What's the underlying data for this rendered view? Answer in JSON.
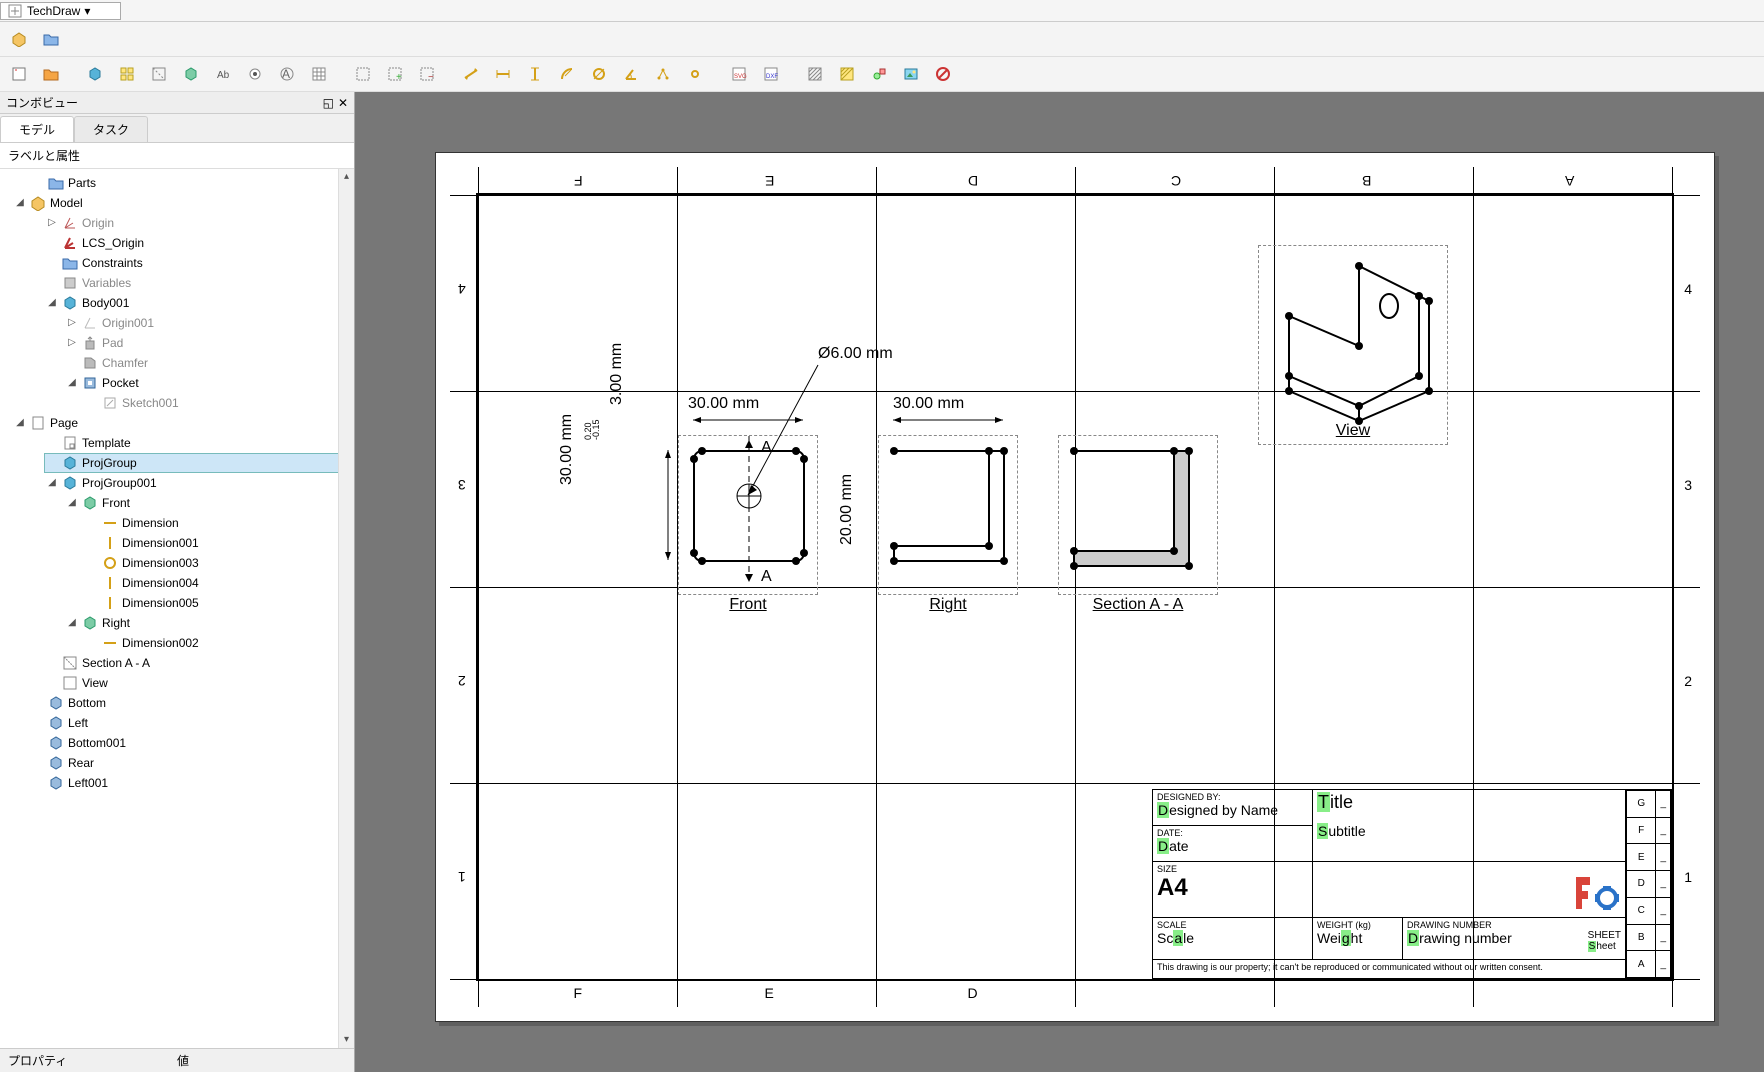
{
  "app": {
    "workbench": "TechDraw"
  },
  "left_panel": {
    "title": "コンボビュー",
    "tabs": {
      "model": "モデル",
      "task": "タスク"
    },
    "labels_header": "ラベルと属性",
    "prop_header": {
      "property": "プロパティ",
      "value": "値"
    },
    "tree": {
      "parts": "Parts",
      "model": "Model",
      "origin": "Origin",
      "lcs_origin": "LCS_Origin",
      "constraints": "Constraints",
      "variables": "Variables",
      "body001": "Body001",
      "origin001": "Origin001",
      "pad": "Pad",
      "chamfer": "Chamfer",
      "pocket": "Pocket",
      "sketch001": "Sketch001",
      "page": "Page",
      "template": "Template",
      "projgroup": "ProjGroup",
      "projgroup001": "ProjGroup001",
      "front": "Front",
      "dimension": "Dimension",
      "dimension001": "Dimension001",
      "dimension003": "Dimension003",
      "dimension004": "Dimension004",
      "dimension005": "Dimension005",
      "right": "Right",
      "dimension002": "Dimension002",
      "section_a_a": "Section A - A",
      "view": "View",
      "bottom": "Bottom",
      "left": "Left",
      "bottom001": "Bottom001",
      "rear": "Rear",
      "left001": "Left001"
    }
  },
  "drawing": {
    "col_letters_top": [
      "F",
      "E",
      "D",
      "C",
      "B",
      "A"
    ],
    "col_letters_bottom": [
      "F",
      "E",
      "D"
    ],
    "row_nums": [
      "4",
      "3",
      "2",
      "1"
    ],
    "views": {
      "front": {
        "label": "Front",
        "dims": {
          "w": "30.00 mm",
          "h": "30.00 mm",
          "t": "3.00 mm",
          "tol_plus": "0.20",
          "tol_minus": "-0.15"
        },
        "balloon": "Ø6.00 mm",
        "section_letter": "A"
      },
      "right": {
        "label": "Right",
        "dims": {
          "w": "30.00 mm",
          "h": "20.00 mm"
        }
      },
      "section": {
        "label": "Section A - A"
      },
      "iso": {
        "label": "View"
      }
    },
    "titleblock": {
      "designed_by_label": "DESIGNED BY:",
      "designed_by": "Designed by Name",
      "date_label": "DATE:",
      "date": "Date",
      "size_label": "SIZE",
      "size": "A4",
      "title": "Title",
      "subtitle": "Subtitle",
      "scale_label": "SCALE",
      "scale": "Scale",
      "weight_label": "WEIGHT (kg)",
      "weight": "Weight",
      "drawing_no_label": "DRAWING NUMBER",
      "drawing_no": "Drawing number",
      "sheet_label": "SHEET",
      "sheet": "Sheet",
      "disclaimer": "This drawing is our property; it can't be reproduced or communicated without our written consent.",
      "zone_letters": [
        "G",
        "F",
        "E",
        "D",
        "C",
        "B",
        "A"
      ],
      "zone_dash": "_"
    }
  },
  "icons": {
    "part": "📦",
    "folder": "📁",
    "page": "📄",
    "body": "🟦",
    "proj": "🟩",
    "axis": "↘",
    "pad": "⬆",
    "chamfer": "◢",
    "pocket": "⬇",
    "sketch": "✎",
    "dim_h": "↔",
    "dim_v": "↕",
    "dim_d": "⊘"
  }
}
